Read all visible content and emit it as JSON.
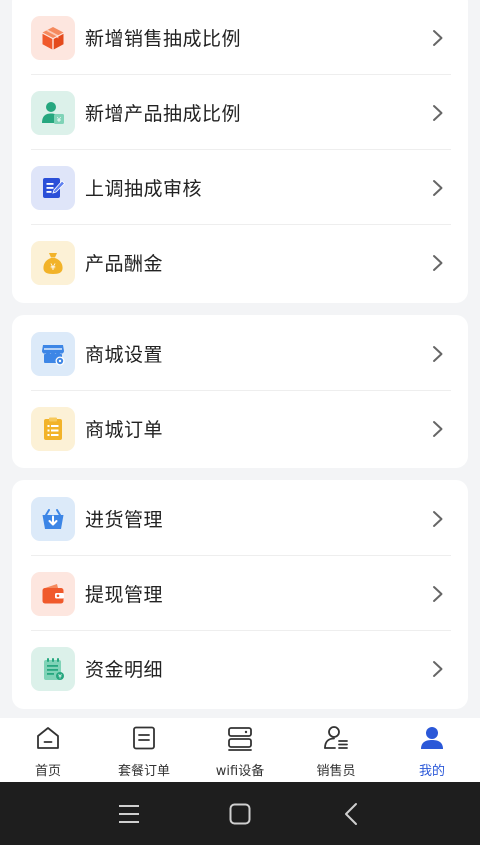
{
  "groups": [
    {
      "items": [
        {
          "label": "新增销售抽成比例",
          "icon": "box-icon",
          "icon_bg": "#fde6df",
          "icon_color": "#f05a2c"
        },
        {
          "label": "新增产品抽成比例",
          "icon": "user-yen-icon",
          "icon_bg": "#dcf1ea",
          "icon_color": "#26a77f"
        },
        {
          "label": "上调抽成审核",
          "icon": "edit-doc-icon",
          "icon_bg": "#dfe5f9",
          "icon_color": "#2b4fd8"
        },
        {
          "label": "产品酬金",
          "icon": "money-bag-icon",
          "icon_bg": "#fcf1d6",
          "icon_color": "#f2b329"
        }
      ]
    },
    {
      "items": [
        {
          "label": "商城设置",
          "icon": "store-settings-icon",
          "icon_bg": "#dceaf9",
          "icon_color": "#3d86e6"
        },
        {
          "label": "商城订单",
          "icon": "clipboard-list-icon",
          "icon_bg": "#fcf1d6",
          "icon_color": "#f2b329"
        }
      ]
    },
    {
      "items": [
        {
          "label": "进货管理",
          "icon": "basket-download-icon",
          "icon_bg": "#dceaf9",
          "icon_color": "#3d86e6"
        },
        {
          "label": "提现管理",
          "icon": "wallet-icon",
          "icon_bg": "#fde6df",
          "icon_color": "#f05a2c"
        },
        {
          "label": "资金明细",
          "icon": "ledger-icon",
          "icon_bg": "#dcf1ea",
          "icon_color": "#26a77f"
        }
      ]
    }
  ],
  "tabbar": {
    "active_color": "#2b58d8",
    "tabs": [
      {
        "label": "首页",
        "icon": "home-icon"
      },
      {
        "label": "套餐订单",
        "icon": "order-icon"
      },
      {
        "label": "wifi设备",
        "icon": "router-icon"
      },
      {
        "label": "销售员",
        "icon": "salesperson-icon"
      },
      {
        "label": "我的",
        "icon": "profile-icon",
        "active": true
      }
    ]
  },
  "system_nav": {
    "buttons": [
      "menu-icon",
      "home-square-icon",
      "back-icon"
    ]
  }
}
